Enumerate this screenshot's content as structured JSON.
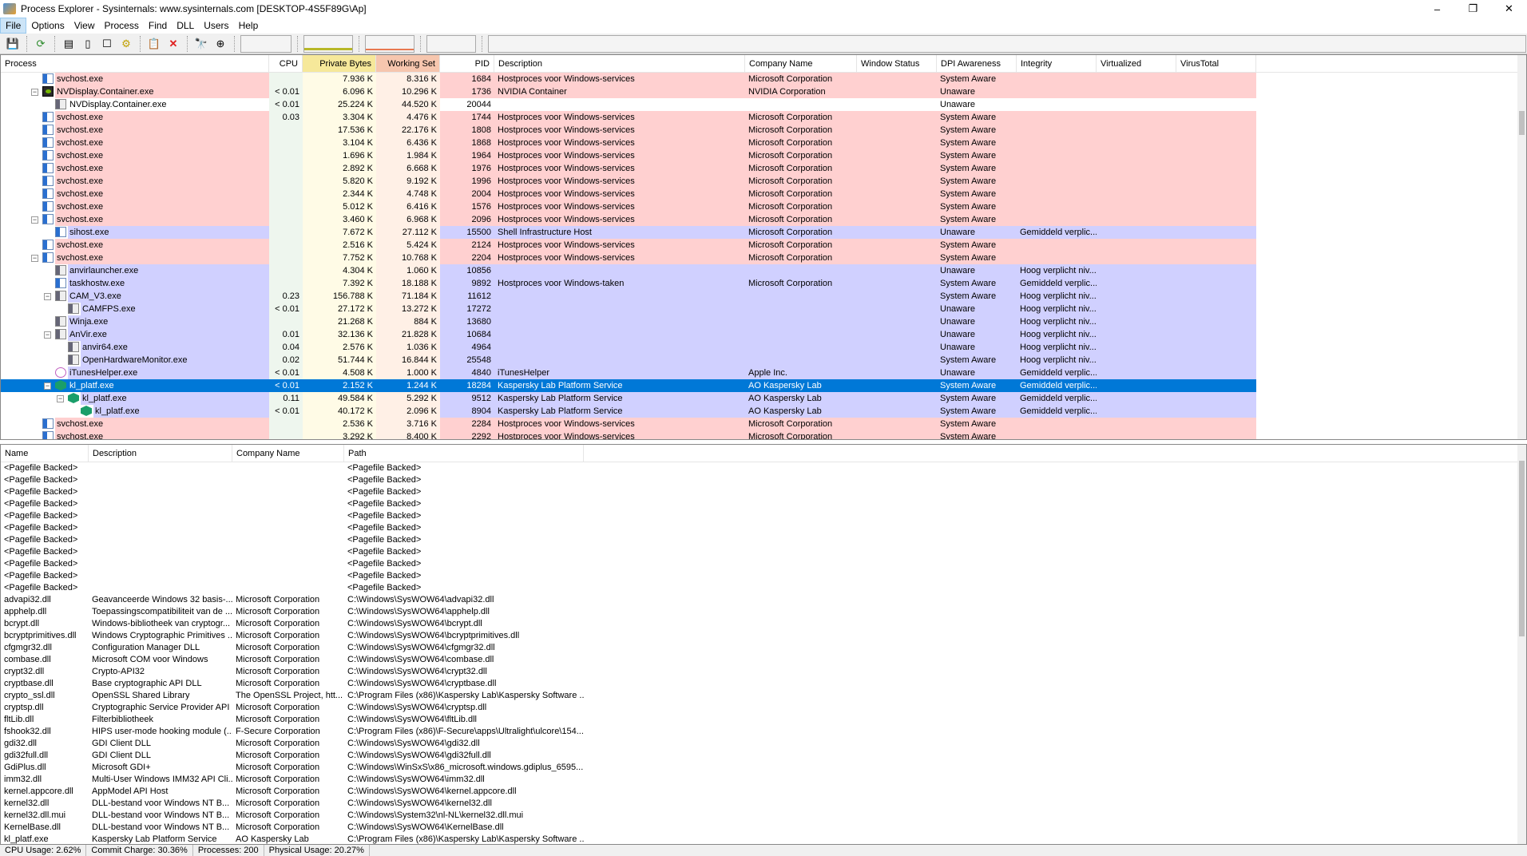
{
  "window": {
    "title": "Process Explorer - Sysinternals: www.sysinternals.com [DESKTOP-4S5F89G\\Ap]",
    "minimize": "–",
    "maximize": "❐",
    "close": "✕"
  },
  "menu": [
    "File",
    "Options",
    "View",
    "Process",
    "Find",
    "DLL",
    "Users",
    "Help"
  ],
  "toolbar": [
    "save-icon",
    "refresh-icon",
    "system-info-icon",
    "properties-icon",
    "window-icon",
    "cpu-icon",
    "kill-tree-icon",
    "kill-process-icon",
    "find-icon",
    "target-icon"
  ],
  "colors": {
    "services": "#ffd0d0",
    "own": "#d0d0ff",
    "selected": "#0078d7",
    "private_bytes_header": "#f6e89a",
    "working_set_header": "#f6c6ae"
  },
  "process_columns": [
    "Process",
    "CPU",
    "Private Bytes",
    "Working Set",
    "PID",
    "Description",
    "Company Name",
    "Window Status",
    "DPI Awareness",
    "Integrity",
    "Virtualized",
    "VirusTotal"
  ],
  "processes": [
    [
      "svchost.exe",
      0,
      "",
      "svc",
      "",
      "7.936 K",
      "8.316 K",
      "1684",
      "Hostproces voor Windows-services",
      "Microsoft Corporation",
      "System Aware",
      "",
      "pink"
    ],
    [
      "NVDisplay.Container.exe",
      0,
      "-",
      "nv",
      "< 0.01",
      "6.096 K",
      "10.296 K",
      "1736",
      "NVIDIA Container",
      "NVIDIA Corporation",
      "Unaware",
      "",
      "pink"
    ],
    [
      "NVDisplay.Container.exe",
      1,
      "",
      "gray",
      "< 0.01",
      "25.224 K",
      "44.520 K",
      "20044",
      "",
      "",
      "Unaware",
      "",
      "white"
    ],
    [
      "svchost.exe",
      0,
      "",
      "svc",
      "0.03",
      "3.304 K",
      "4.476 K",
      "1744",
      "Hostproces voor Windows-services",
      "Microsoft Corporation",
      "System Aware",
      "",
      "pink"
    ],
    [
      "svchost.exe",
      0,
      "",
      "svc",
      "",
      "17.536 K",
      "22.176 K",
      "1808",
      "Hostproces voor Windows-services",
      "Microsoft Corporation",
      "System Aware",
      "",
      "pink"
    ],
    [
      "svchost.exe",
      0,
      "",
      "svc",
      "",
      "3.104 K",
      "6.436 K",
      "1868",
      "Hostproces voor Windows-services",
      "Microsoft Corporation",
      "System Aware",
      "",
      "pink"
    ],
    [
      "svchost.exe",
      0,
      "",
      "svc",
      "",
      "1.696 K",
      "1.984 K",
      "1964",
      "Hostproces voor Windows-services",
      "Microsoft Corporation",
      "System Aware",
      "",
      "pink"
    ],
    [
      "svchost.exe",
      0,
      "",
      "svc",
      "",
      "2.892 K",
      "6.668 K",
      "1976",
      "Hostproces voor Windows-services",
      "Microsoft Corporation",
      "System Aware",
      "",
      "pink"
    ],
    [
      "svchost.exe",
      0,
      "",
      "svc",
      "",
      "5.820 K",
      "9.192 K",
      "1996",
      "Hostproces voor Windows-services",
      "Microsoft Corporation",
      "System Aware",
      "",
      "pink"
    ],
    [
      "svchost.exe",
      0,
      "",
      "svc",
      "",
      "2.344 K",
      "4.748 K",
      "2004",
      "Hostproces voor Windows-services",
      "Microsoft Corporation",
      "System Aware",
      "",
      "pink"
    ],
    [
      "svchost.exe",
      0,
      "",
      "svc",
      "",
      "5.012 K",
      "6.416 K",
      "1576",
      "Hostproces voor Windows-services",
      "Microsoft Corporation",
      "System Aware",
      "",
      "pink"
    ],
    [
      "svchost.exe",
      0,
      "-",
      "svc",
      "",
      "3.460 K",
      "6.968 K",
      "2096",
      "Hostproces voor Windows-services",
      "Microsoft Corporation",
      "System Aware",
      "",
      "pink"
    ],
    [
      "sihost.exe",
      1,
      "",
      "svc",
      "",
      "7.672 K",
      "27.112 K",
      "15500",
      "Shell Infrastructure Host",
      "Microsoft Corporation",
      "Unaware",
      "Gemiddeld verplic...",
      "lav"
    ],
    [
      "svchost.exe",
      0,
      "",
      "svc",
      "",
      "2.516 K",
      "5.424 K",
      "2124",
      "Hostproces voor Windows-services",
      "Microsoft Corporation",
      "System Aware",
      "",
      "pink"
    ],
    [
      "svchost.exe",
      0,
      "-",
      "svc",
      "",
      "7.752 K",
      "10.768 K",
      "2204",
      "Hostproces voor Windows-services",
      "Microsoft Corporation",
      "System Aware",
      "",
      "pink"
    ],
    [
      "anvirlauncher.exe",
      1,
      "",
      "gray",
      "",
      "4.304 K",
      "1.060 K",
      "10856",
      "",
      "",
      "Unaware",
      "Hoog verplicht niv...",
      "lav"
    ],
    [
      "taskhostw.exe",
      1,
      "",
      "svc",
      "",
      "7.392 K",
      "18.188 K",
      "9892",
      "Hostproces voor Windows-taken",
      "Microsoft Corporation",
      "System Aware",
      "Gemiddeld verplic...",
      "lav"
    ],
    [
      "CAM_V3.exe",
      1,
      "-",
      "gray",
      "0.23",
      "156.788 K",
      "71.184 K",
      "11612",
      "",
      "",
      "System Aware",
      "Hoog verplicht niv...",
      "lav"
    ],
    [
      "CAMFPS.exe",
      2,
      "",
      "gray",
      "< 0.01",
      "27.172 K",
      "13.272 K",
      "17272",
      "",
      "",
      "Unaware",
      "Hoog verplicht niv...",
      "lav"
    ],
    [
      "Winja.exe",
      1,
      "",
      "gray",
      "",
      "21.268 K",
      "884 K",
      "13680",
      "",
      "",
      "Unaware",
      "Hoog verplicht niv...",
      "lav"
    ],
    [
      "AnVir.exe",
      1,
      "-",
      "gray",
      "0.01",
      "32.136 K",
      "21.828 K",
      "10684",
      "",
      "",
      "Unaware",
      "Hoog verplicht niv...",
      "lav"
    ],
    [
      "anvir64.exe",
      2,
      "",
      "gray",
      "0.04",
      "2.576 K",
      "1.036 K",
      "4964",
      "",
      "",
      "Unaware",
      "Hoog verplicht niv...",
      "lav"
    ],
    [
      "OpenHardwareMonitor.exe",
      2,
      "",
      "gray",
      "0.02",
      "51.744 K",
      "16.844 K",
      "25548",
      "",
      "",
      "System Aware",
      "Hoog verplicht niv...",
      "lav"
    ],
    [
      "iTunesHelper.exe",
      1,
      "",
      "it",
      "< 0.01",
      "4.508 K",
      "1.000 K",
      "4840",
      "iTunesHelper",
      "Apple Inc.",
      "Unaware",
      "Gemiddeld verplic...",
      "lav"
    ],
    [
      "kl_platf.exe",
      1,
      "-",
      "kl",
      "< 0.01",
      "2.152 K",
      "1.244 K",
      "18284",
      "Kaspersky Lab Platform Service",
      "AO Kaspersky Lab",
      "System Aware",
      "Gemiddeld verplic...",
      "sel"
    ],
    [
      "kl_platf.exe",
      2,
      "-",
      "kl",
      "0.11",
      "49.584 K",
      "5.292 K",
      "9512",
      "Kaspersky Lab Platform Service",
      "AO Kaspersky Lab",
      "System Aware",
      "Gemiddeld verplic...",
      "lav"
    ],
    [
      "kl_platf.exe",
      3,
      "",
      "kl",
      "< 0.01",
      "40.172 K",
      "2.096 K",
      "8904",
      "Kaspersky Lab Platform Service",
      "AO Kaspersky Lab",
      "System Aware",
      "Gemiddeld verplic...",
      "lav"
    ],
    [
      "svchost.exe",
      0,
      "",
      "svc",
      "",
      "2.536 K",
      "3.716 K",
      "2284",
      "Hostproces voor Windows-services",
      "Microsoft Corporation",
      "System Aware",
      "",
      "pink"
    ],
    [
      "svchost.exe",
      0,
      "",
      "svc",
      "",
      "3.292 K",
      "8.400 K",
      "2292",
      "Hostproces voor Windows-services",
      "Microsoft Corporation",
      "System Aware",
      "",
      "pink"
    ]
  ],
  "dll_columns": [
    "Name",
    "Description",
    "Company Name",
    "Path"
  ],
  "dlls": [
    [
      "<Pagefile Backed>",
      "",
      "",
      "<Pagefile Backed>"
    ],
    [
      "<Pagefile Backed>",
      "",
      "",
      "<Pagefile Backed>"
    ],
    [
      "<Pagefile Backed>",
      "",
      "",
      "<Pagefile Backed>"
    ],
    [
      "<Pagefile Backed>",
      "",
      "",
      "<Pagefile Backed>"
    ],
    [
      "<Pagefile Backed>",
      "",
      "",
      "<Pagefile Backed>"
    ],
    [
      "<Pagefile Backed>",
      "",
      "",
      "<Pagefile Backed>"
    ],
    [
      "<Pagefile Backed>",
      "",
      "",
      "<Pagefile Backed>"
    ],
    [
      "<Pagefile Backed>",
      "",
      "",
      "<Pagefile Backed>"
    ],
    [
      "<Pagefile Backed>",
      "",
      "",
      "<Pagefile Backed>"
    ],
    [
      "<Pagefile Backed>",
      "",
      "",
      "<Pagefile Backed>"
    ],
    [
      "<Pagefile Backed>",
      "",
      "",
      "<Pagefile Backed>"
    ],
    [
      "advapi32.dll",
      "Geavanceerde Windows 32 basis-...",
      "Microsoft Corporation",
      "C:\\Windows\\SysWOW64\\advapi32.dll"
    ],
    [
      "apphelp.dll",
      "Toepassingscompatibiliteit van de ...",
      "Microsoft Corporation",
      "C:\\Windows\\SysWOW64\\apphelp.dll"
    ],
    [
      "bcrypt.dll",
      "Windows-bibliotheek van cryptogr...",
      "Microsoft Corporation",
      "C:\\Windows\\SysWOW64\\bcrypt.dll"
    ],
    [
      "bcryptprimitives.dll",
      "Windows Cryptographic Primitives ...",
      "Microsoft Corporation",
      "C:\\Windows\\SysWOW64\\bcryptprimitives.dll"
    ],
    [
      "cfgmgr32.dll",
      "Configuration Manager DLL",
      "Microsoft Corporation",
      "C:\\Windows\\SysWOW64\\cfgmgr32.dll"
    ],
    [
      "combase.dll",
      "Microsoft COM voor Windows",
      "Microsoft Corporation",
      "C:\\Windows\\SysWOW64\\combase.dll"
    ],
    [
      "crypt32.dll",
      "Crypto-API32",
      "Microsoft Corporation",
      "C:\\Windows\\SysWOW64\\crypt32.dll"
    ],
    [
      "cryptbase.dll",
      "Base cryptographic API DLL",
      "Microsoft Corporation",
      "C:\\Windows\\SysWOW64\\cryptbase.dll"
    ],
    [
      "crypto_ssl.dll",
      "OpenSSL Shared Library",
      "The OpenSSL Project, htt...",
      "C:\\Program Files (x86)\\Kaspersky Lab\\Kaspersky Software ..."
    ],
    [
      "cryptsp.dll",
      "Cryptographic Service Provider API",
      "Microsoft Corporation",
      "C:\\Windows\\SysWOW64\\cryptsp.dll"
    ],
    [
      "fltLib.dll",
      "Filterbibliotheek",
      "Microsoft Corporation",
      "C:\\Windows\\SysWOW64\\fltLib.dll"
    ],
    [
      "fshook32.dll",
      "HIPS user-mode hooking module (...",
      "F-Secure Corporation",
      "C:\\Program Files (x86)\\F-Secure\\apps\\Ultralight\\ulcore\\154..."
    ],
    [
      "gdi32.dll",
      "GDI Client DLL",
      "Microsoft Corporation",
      "C:\\Windows\\SysWOW64\\gdi32.dll"
    ],
    [
      "gdi32full.dll",
      "GDI Client DLL",
      "Microsoft Corporation",
      "C:\\Windows\\SysWOW64\\gdi32full.dll"
    ],
    [
      "GdiPlus.dll",
      "Microsoft GDI+",
      "Microsoft Corporation",
      "C:\\Windows\\WinSxS\\x86_microsoft.windows.gdiplus_6595..."
    ],
    [
      "imm32.dll",
      "Multi-User Windows IMM32 API Cli...",
      "Microsoft Corporation",
      "C:\\Windows\\SysWOW64\\imm32.dll"
    ],
    [
      "kernel.appcore.dll",
      "AppModel API Host",
      "Microsoft Corporation",
      "C:\\Windows\\SysWOW64\\kernel.appcore.dll"
    ],
    [
      "kernel32.dll",
      "DLL-bestand voor Windows NT B...",
      "Microsoft Corporation",
      "C:\\Windows\\SysWOW64\\kernel32.dll"
    ],
    [
      "kernel32.dll.mui",
      "DLL-bestand voor Windows NT B...",
      "Microsoft Corporation",
      "C:\\Windows\\System32\\nl-NL\\kernel32.dll.mui"
    ],
    [
      "KernelBase.dll",
      "DLL-bestand voor Windows NT B...",
      "Microsoft Corporation",
      "C:\\Windows\\SysWOW64\\KernelBase.dll"
    ],
    [
      "kl_platf.exe",
      "Kaspersky Lab Platform Service",
      "AO Kaspersky Lab",
      "C:\\Program Files (x86)\\Kaspersky Lab\\Kaspersky Software ..."
    ]
  ],
  "status": {
    "cpu": "CPU Usage: 2.62%",
    "commit": "Commit Charge: 30.36%",
    "processes": "Processes: 200",
    "physical": "Physical Usage: 20.27%"
  }
}
